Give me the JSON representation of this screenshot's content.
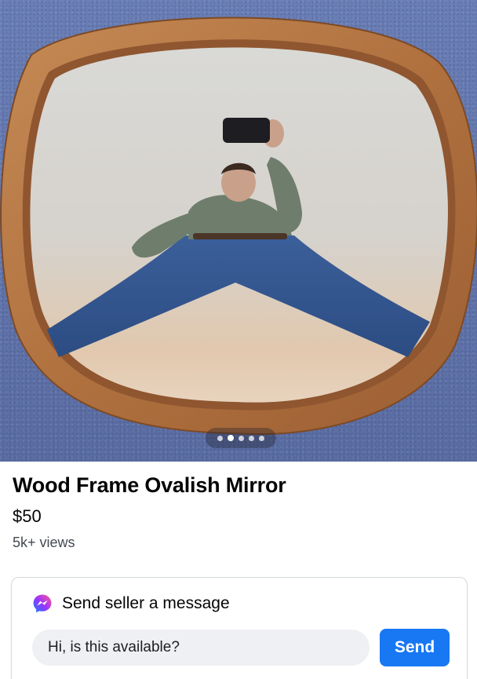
{
  "listing": {
    "title": "Wood Frame Ovalish Mirror",
    "price": "$50",
    "views": "5k+ views",
    "photo_count": 5,
    "active_photo_index": 1
  },
  "message_box": {
    "header_icon": "messenger-icon",
    "header_label": "Send seller a message",
    "input_value": "Hi, is this available?",
    "send_label": "Send"
  },
  "colors": {
    "send_button": "#1877f2",
    "input_background": "#eef0f3",
    "carpet": "#6276ad",
    "frame_wood": "#b87642"
  }
}
